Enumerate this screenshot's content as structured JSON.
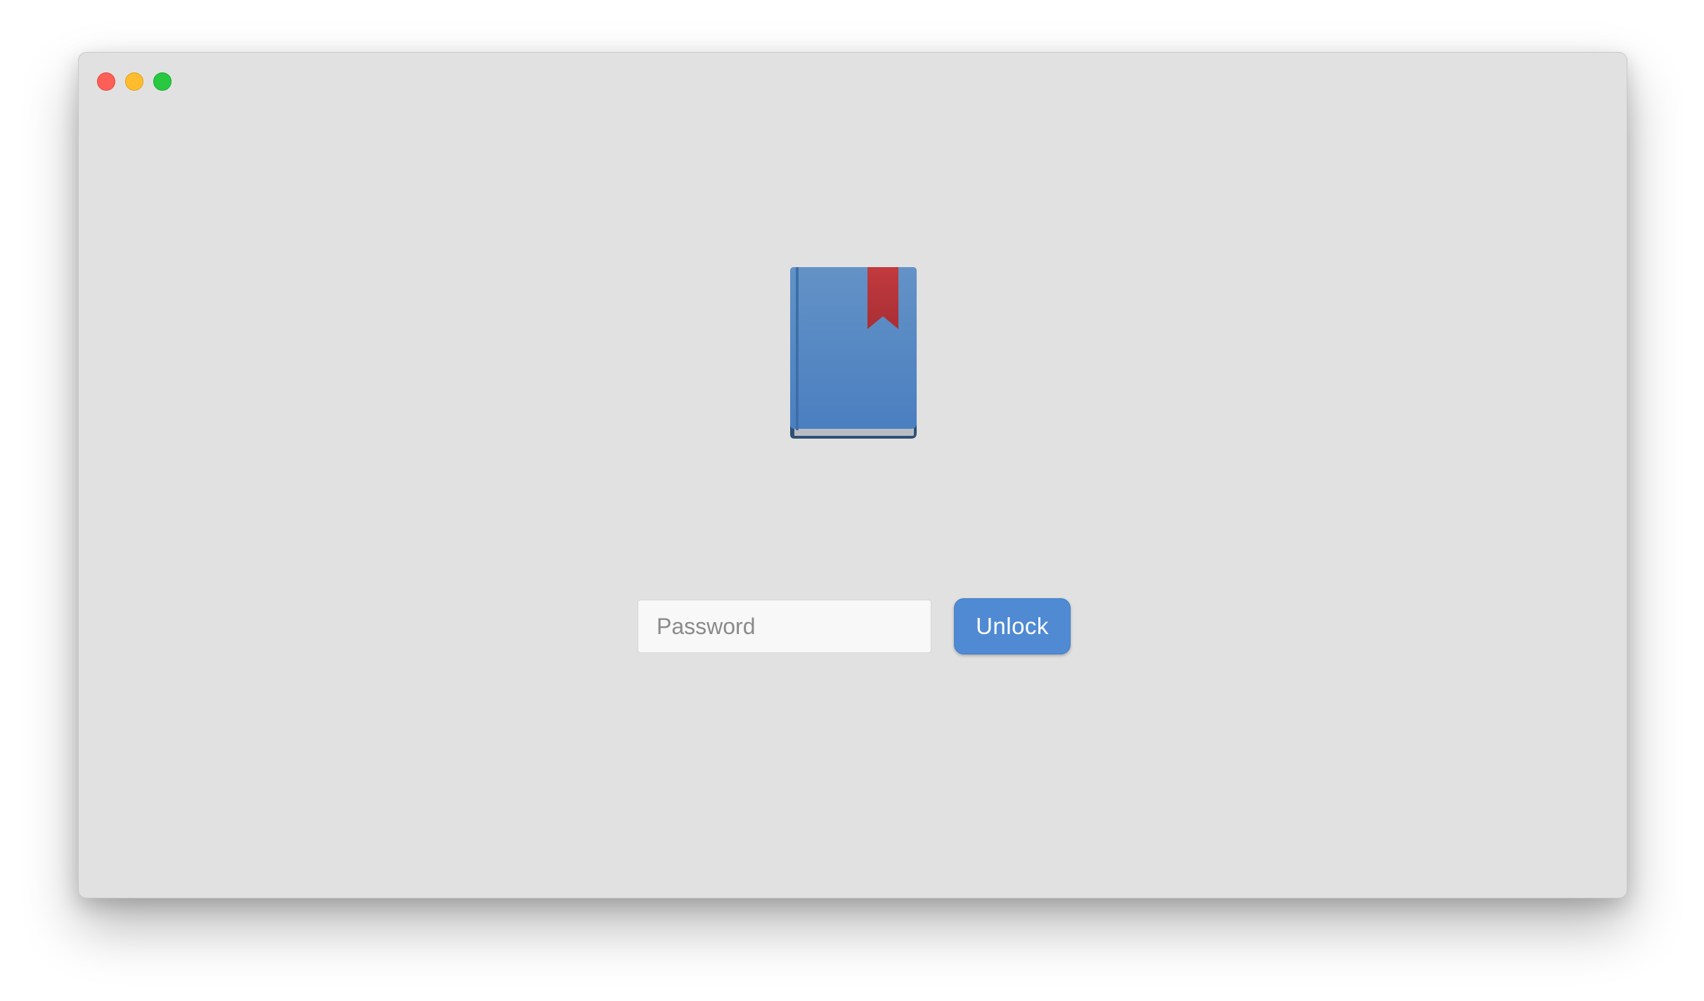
{
  "window": {
    "controls": {
      "close": {
        "icon": "close-traffic-light-icon",
        "color": "#fe5f57"
      },
      "minimize": {
        "icon": "minimize-traffic-light-icon",
        "color": "#febc2e"
      },
      "maximize": {
        "icon": "maximize-traffic-light-icon",
        "color": "#28c840"
      }
    }
  },
  "app": {
    "icon": "bookmarked-book-icon",
    "icon_colors": {
      "cover": "#5a8cc8",
      "bookmark": "#c0393d"
    }
  },
  "unlock_form": {
    "password_value": "",
    "password_placeholder": "Password",
    "unlock_label": "Unlock",
    "accent_color": "#4f8ad2"
  }
}
